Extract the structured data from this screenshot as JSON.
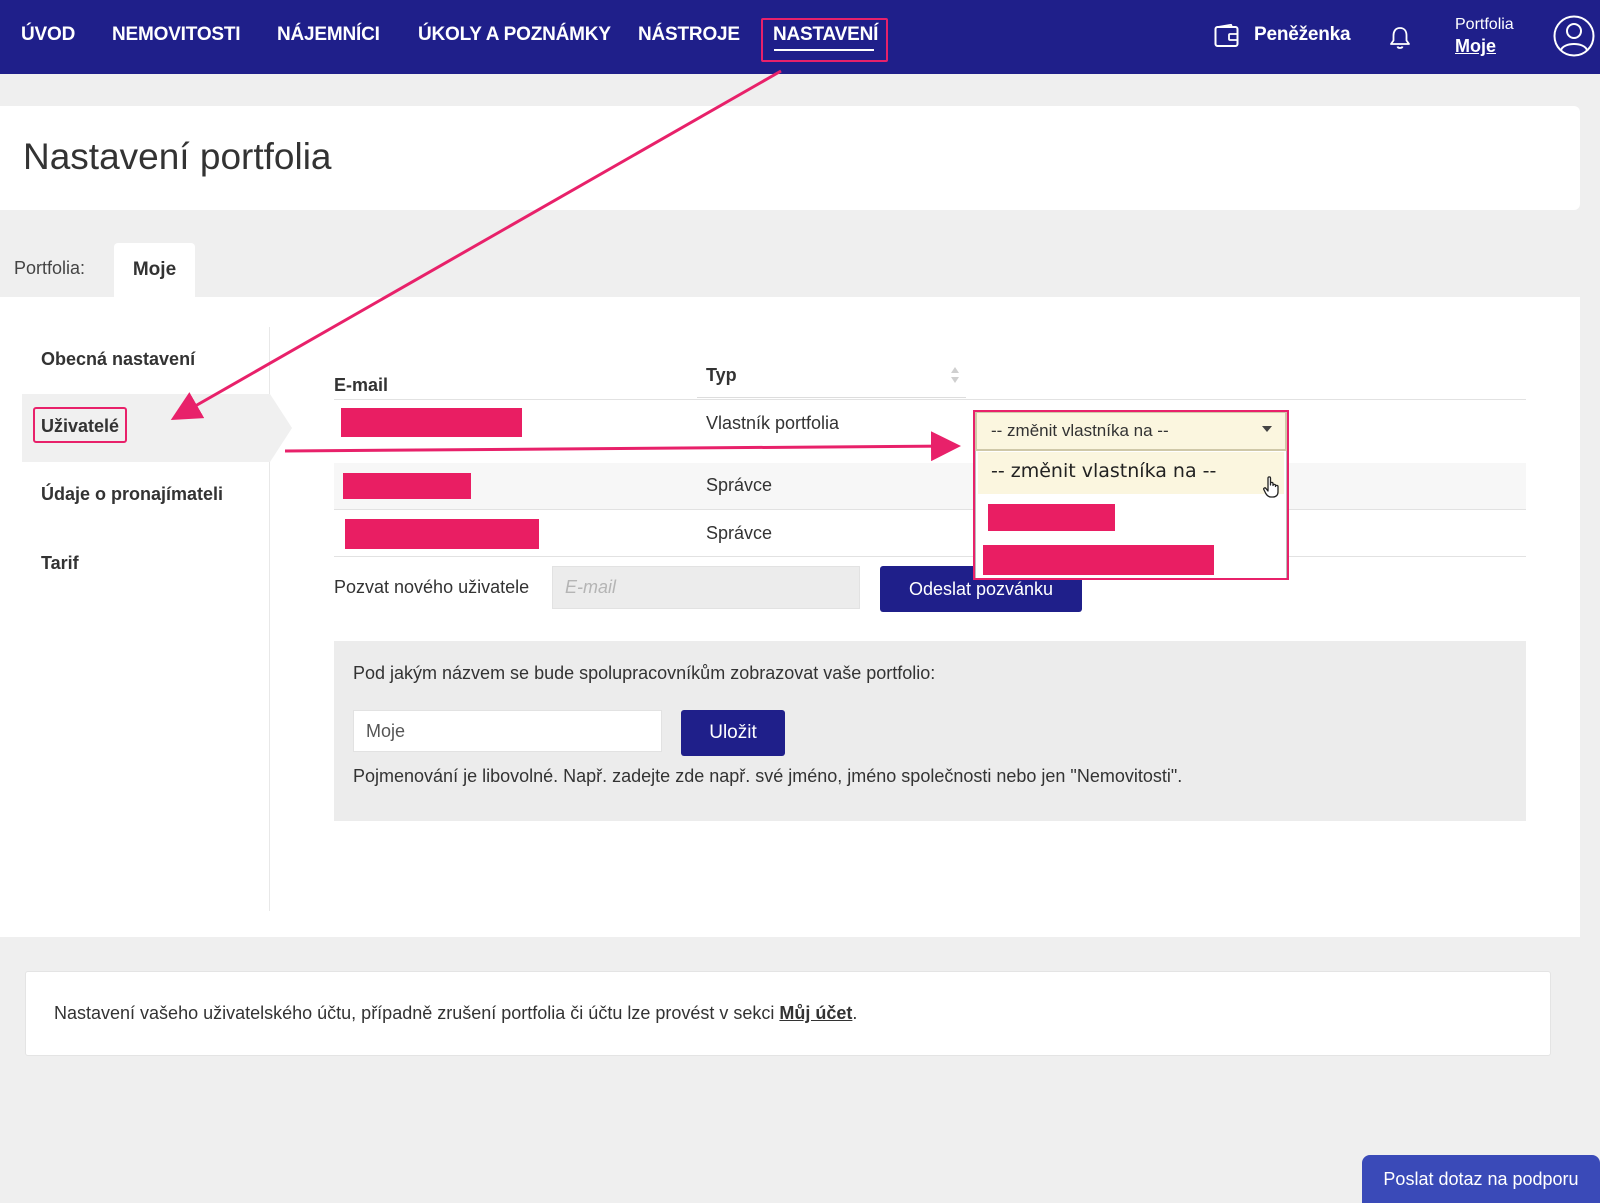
{
  "nav": {
    "items": [
      "ÚVOD",
      "NEMOVITOSTI",
      "NÁJEMNÍCI",
      "ÚKOLY A POZNÁMKY",
      "NÁSTROJE",
      "NASTAVENÍ"
    ],
    "active": "NASTAVENÍ",
    "wallet_label": "Peněženka",
    "portfolio_label": "Portfolia",
    "portfolio_value": "Moje"
  },
  "page": {
    "title": "Nastavení portfolia"
  },
  "tabs": {
    "label": "Portfolia:",
    "active": "Moje"
  },
  "sidebar": {
    "items": [
      "Obecná nastavení",
      "Uživatelé",
      "Údaje o pronajímateli",
      "Tarif"
    ],
    "active": "Uživatelé"
  },
  "table": {
    "headers": {
      "email": "E-mail",
      "type": "Typ"
    },
    "rows": [
      {
        "type": "Vlastník portfolia"
      },
      {
        "type": "Správce"
      },
      {
        "type": "Správce"
      }
    ],
    "owner_select": {
      "selected": "-- změnit vlastníka na --",
      "options": [
        "-- změnit vlastníka na --"
      ]
    }
  },
  "invite": {
    "label": "Pozvat nového uživatele",
    "placeholder": "E-mail",
    "button": "Odeslat pozvánku"
  },
  "name_panel": {
    "question": "Pod jakým názvem se bude spolupracovníkům zobrazovat vaše portfolio:",
    "value": "Moje",
    "save_button": "Uložit",
    "hint": "Pojmenování je libovolné. Např. zadejte zde např. své jméno, jméno společnosti nebo jen \"Nemovitosti\"."
  },
  "footer": {
    "text_before": "Nastavení vašeho uživatelského účtu, případně zrušení portfolia či účtu lze provést v sekci ",
    "link": "Můj účet",
    "text_after": "."
  },
  "support_button": "Poslat dotaz na podporu",
  "colors": {
    "nav_bg": "#1f1f8a",
    "accent": "#e8216a",
    "redaction": "#e91e63",
    "select_bg": "#fbf6df"
  }
}
